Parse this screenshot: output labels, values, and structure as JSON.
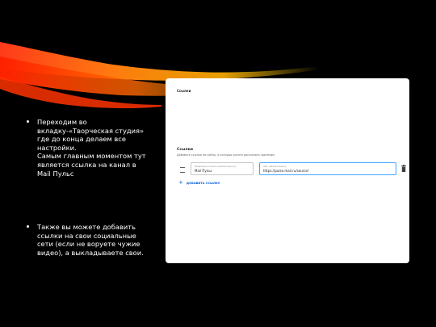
{
  "colors": {
    "background": "#000000",
    "text": "#ffffff",
    "panel": "#ffffff",
    "accent_link": "#065fd4",
    "focus_border": "#3ea6ff"
  },
  "bullets": [
    "Переходим во вкладку-«Творческая студия» где до конца делаем все настройки.\nСамым главным моментом тут является ссылка на канал в Mail Пульс",
    "Также вы можете добавить ссылки на свои социальные сети (если не воруете чужие видео), а выкладываете свои."
  ],
  "panel": {
    "header": "Ссылки",
    "links_title": "Ссылки",
    "links_subtitle": "Добавьте ссылки на сайты, о которых хотите рассказать зрителям",
    "name_field": {
      "label": "Название (ссылки (обязательно))",
      "value": "Mail Пульс"
    },
    "url_field": {
      "label": "URL (обязательно)",
      "value": "https://pulse.mail.ru/source/"
    },
    "add_link_label": "ДОБАВИТЬ ССЫЛКУ",
    "icons": {
      "drag": "drag-handle-icon",
      "delete": "trash-icon",
      "add": "plus-icon"
    }
  }
}
